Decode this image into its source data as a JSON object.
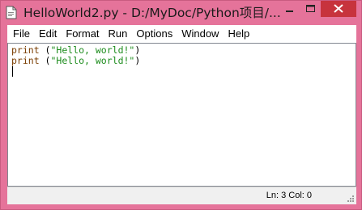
{
  "window": {
    "title": "HelloWorld2.py - D:/MyDoc/Python项目/...",
    "title_color": "#e5739a",
    "close_color": "#c7333d"
  },
  "menu": {
    "items": [
      {
        "label": "File"
      },
      {
        "label": "Edit"
      },
      {
        "label": "Format"
      },
      {
        "label": "Run"
      },
      {
        "label": "Options"
      },
      {
        "label": "Window"
      },
      {
        "label": "Help"
      }
    ]
  },
  "editor": {
    "lines": [
      {
        "keyword": "print",
        "mid": " (",
        "string": "\"Hello, world!\"",
        "end": ")"
      },
      {
        "keyword": "print",
        "mid": " (",
        "string": "\"Hello, world!\"",
        "end": ")"
      }
    ],
    "keyword_color": "#7a3d00",
    "string_color": "#1c8c1c"
  },
  "status": {
    "text": "Ln: 3  Col: 0"
  },
  "icons": {
    "app": "python-idle-icon",
    "minimize": "minimize-icon",
    "maximize": "maximize-icon",
    "close": "close-icon",
    "grip": "resize-grip-icon"
  }
}
